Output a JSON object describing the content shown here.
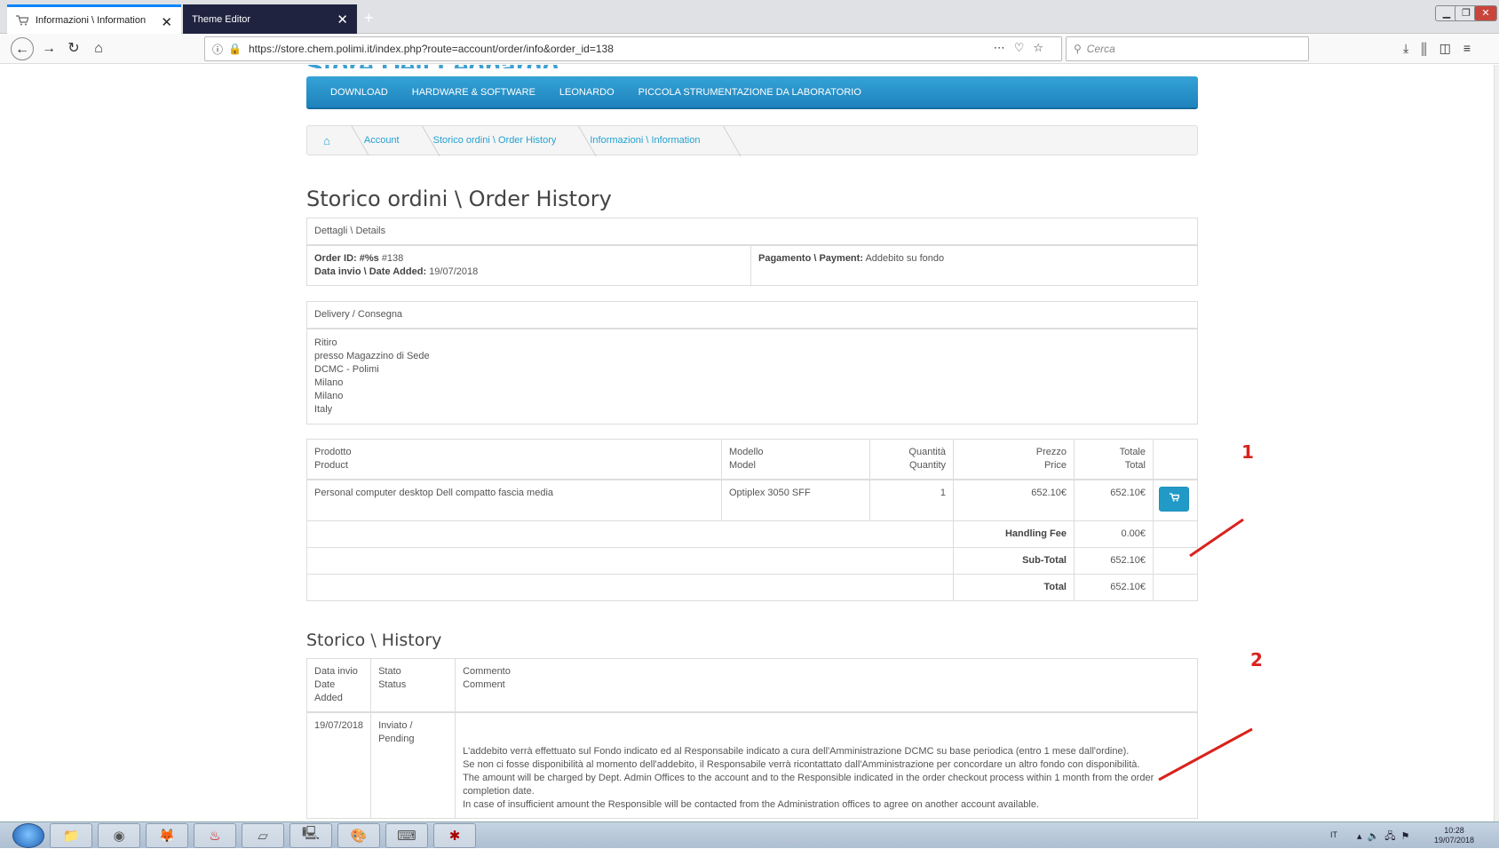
{
  "browser": {
    "tabs": [
      {
        "label": "Informazioni \\ Information",
        "active": true
      },
      {
        "label": "Theme Editor",
        "active": false
      }
    ],
    "url": "https://store.chem.polimi.it/index.php?route=account/order/info&order_id=138",
    "search_placeholder": "Cerca",
    "new_tab_icon": "+"
  },
  "menu": [
    "DOWNLOAD",
    "HARDWARE & SOFTWARE",
    "LEONARDO",
    "PICCOLA STRUMENTAZIONE DA LABORATORIO"
  ],
  "breadcrumb": [
    "Account",
    "Storico ordini \\ Order History",
    "Informazioni \\ Information"
  ],
  "page_title": "Storico ordini \\ Order History",
  "details": {
    "header": "Dettagli \\ Details",
    "order_id_label": "Order ID: #%s",
    "order_id": "#138",
    "date_label": "Data invio \\ Date Added:",
    "date": "19/07/2018",
    "payment_label": "Pagamento \\ Payment:",
    "payment": "Addebito su fondo"
  },
  "delivery": {
    "header": "Delivery / Consegna",
    "lines": [
      "Ritiro",
      "presso Magazzino di Sede",
      "DCMC - Polimi",
      "Milano",
      "Milano",
      "Italy"
    ]
  },
  "products": {
    "headers": {
      "product": [
        "Prodotto",
        "Product"
      ],
      "model": [
        "Modello",
        "Model"
      ],
      "quantity": [
        "Quantità",
        "Quantity"
      ],
      "price": [
        "Prezzo",
        "Price"
      ],
      "total": [
        "Totale",
        "Total"
      ]
    },
    "rows": [
      {
        "product": "Personal computer desktop Dell compatto fascia media",
        "model": "Optiplex 3050 SFF",
        "quantity": "1",
        "price": "652.10€",
        "total": "652.10€"
      }
    ],
    "totals": [
      {
        "label": "Handling Fee",
        "value": "0.00€"
      },
      {
        "label": "Sub-Total",
        "value": "652.10€"
      },
      {
        "label": "Total",
        "value": "652.10€"
      }
    ]
  },
  "history": {
    "title": "Storico \\ History",
    "headers": {
      "date": [
        "Data invio",
        "Date",
        "Added"
      ],
      "status": [
        "Stato",
        "Status"
      ],
      "comment": [
        "Commento",
        "Comment"
      ]
    },
    "row": {
      "date": "19/07/2018",
      "status": [
        "Inviato /",
        "Pending"
      ],
      "comment": [
        "L'addebito verrà effettuato sul Fondo indicato ed al Responsabile indicato a cura dell'Amministrazione DCMC su base periodica (entro 1 mese dall'ordine).",
        "Se non ci fosse disponibilità al momento dell'addebito, il Responsabile verrà ricontattato dall'Amministrazione per concordare un altro fondo con disponibilità.",
        "The amount will be charged by Dept. Admin Offices to the account and to the Responsible indicated in the order checkout process within 1 month from the order completion date.",
        "In case of insufficient amount the Responsible will be contacted from the Administration offices to agree on another account available."
      ]
    }
  },
  "annotations": [
    "1",
    "2"
  ],
  "taskbar": {
    "language": "IT",
    "time": "10:28",
    "date": "19/07/2018"
  },
  "colors": {
    "accent": "#229ac8",
    "annotation": "#d9221c",
    "link": "#23a1d1"
  }
}
